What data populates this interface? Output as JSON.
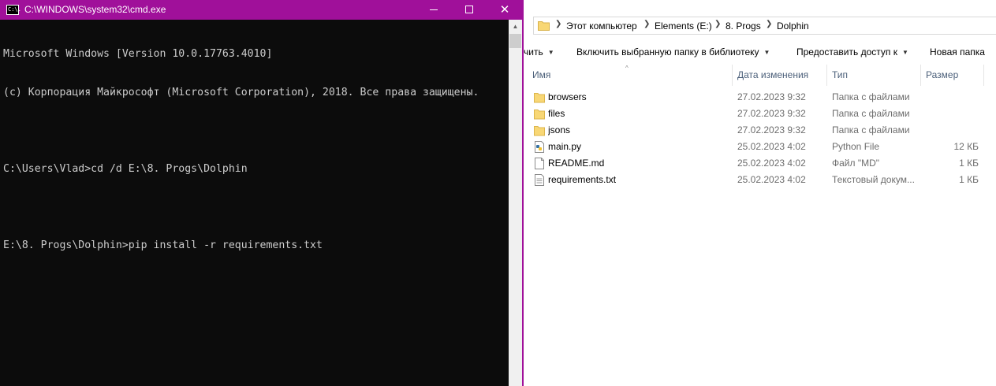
{
  "cmd": {
    "title": "C:\\WINDOWS\\system32\\cmd.exe",
    "icon_text": "C:\\.",
    "buttons": {
      "minimize": "minimize",
      "maximize": "maximize",
      "close": "✕"
    },
    "lines": [
      "Microsoft Windows [Version 10.0.17763.4010]",
      "(c) Корпорация Майкрософт (Microsoft Corporation), 2018. Все права защищены.",
      "",
      "C:\\Users\\Vlad>cd /d E:\\8. Progs\\Dolphin",
      "",
      "E:\\8. Progs\\Dolphin>pip install -r requirements.txt"
    ]
  },
  "explorer": {
    "breadcrumb": [
      "Этот компьютер",
      "Elements (E:)",
      "8. Progs",
      "Dolphin"
    ],
    "ribbon": {
      "share_partial": "чить",
      "include_library": "Включить выбранную папку в библиотеку",
      "share_with": "Предоставить доступ к",
      "new_folder": "Новая папка"
    },
    "columns": {
      "name": "Имя",
      "date": "Дата изменения",
      "type": "Тип",
      "size": "Размер"
    },
    "files": [
      {
        "name": "browsers",
        "date": "27.02.2023 9:32",
        "type": "Папка с файлами",
        "size": "",
        "icon": "folder-icon"
      },
      {
        "name": "files",
        "date": "27.02.2023 9:32",
        "type": "Папка с файлами",
        "size": "",
        "icon": "folder-icon"
      },
      {
        "name": "jsons",
        "date": "27.02.2023 9:32",
        "type": "Папка с файлами",
        "size": "",
        "icon": "folder-icon"
      },
      {
        "name": "main.py",
        "date": "25.02.2023 4:02",
        "type": "Python File",
        "size": "12 КБ",
        "icon": "python-file-icon"
      },
      {
        "name": "README.md",
        "date": "25.02.2023 4:02",
        "type": "Файл \"MD\"",
        "size": "1 КБ",
        "icon": "file-icon"
      },
      {
        "name": "requirements.txt",
        "date": "25.02.2023 4:02",
        "type": "Текстовый докум...",
        "size": "1 КБ",
        "icon": "text-file-icon"
      }
    ]
  },
  "colors": {
    "cmd_titlebar": "#a0109a",
    "cmd_background": "#0c0c0c",
    "cmd_text": "#cccccc",
    "folder_yellow": "#f8d775"
  }
}
